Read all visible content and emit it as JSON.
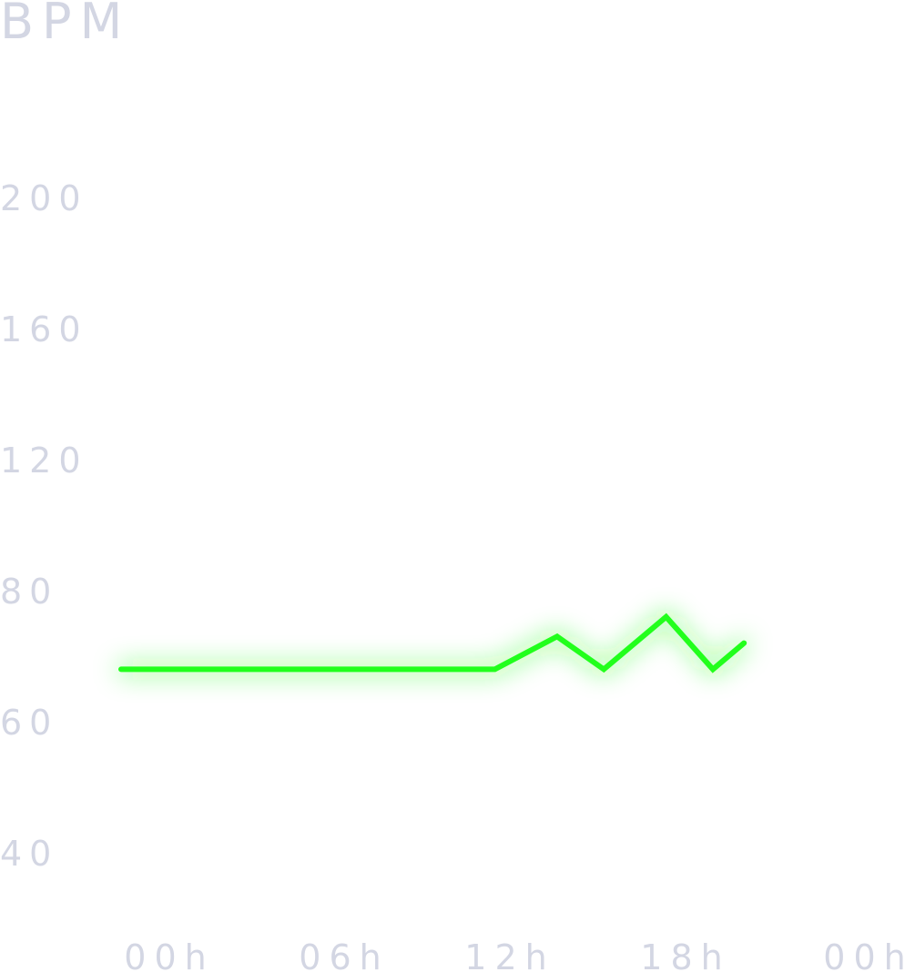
{
  "chart_data": {
    "type": "line",
    "title": "",
    "ylabel": "BPM",
    "xlabel": "",
    "y_ticks": [
      "200",
      "160",
      "120",
      "80",
      "60",
      "40"
    ],
    "x_ticks": [
      "00h",
      "06h",
      "12h",
      "18h",
      "00h"
    ],
    "series": [
      {
        "color": "#22ff1a",
        "points": [
          {
            "x": "00:00",
            "y": 68
          },
          {
            "x": "12:00",
            "y": 68
          },
          {
            "x": "14:00",
            "y": 73
          },
          {
            "x": "15:30",
            "y": 68
          },
          {
            "x": "17:30",
            "y": 76
          },
          {
            "x": "19:00",
            "y": 68
          },
          {
            "x": "20:00",
            "y": 72
          }
        ]
      }
    ],
    "grid": false,
    "line_color": "#22ff1a",
    "label_color": "#d3d6e3"
  }
}
